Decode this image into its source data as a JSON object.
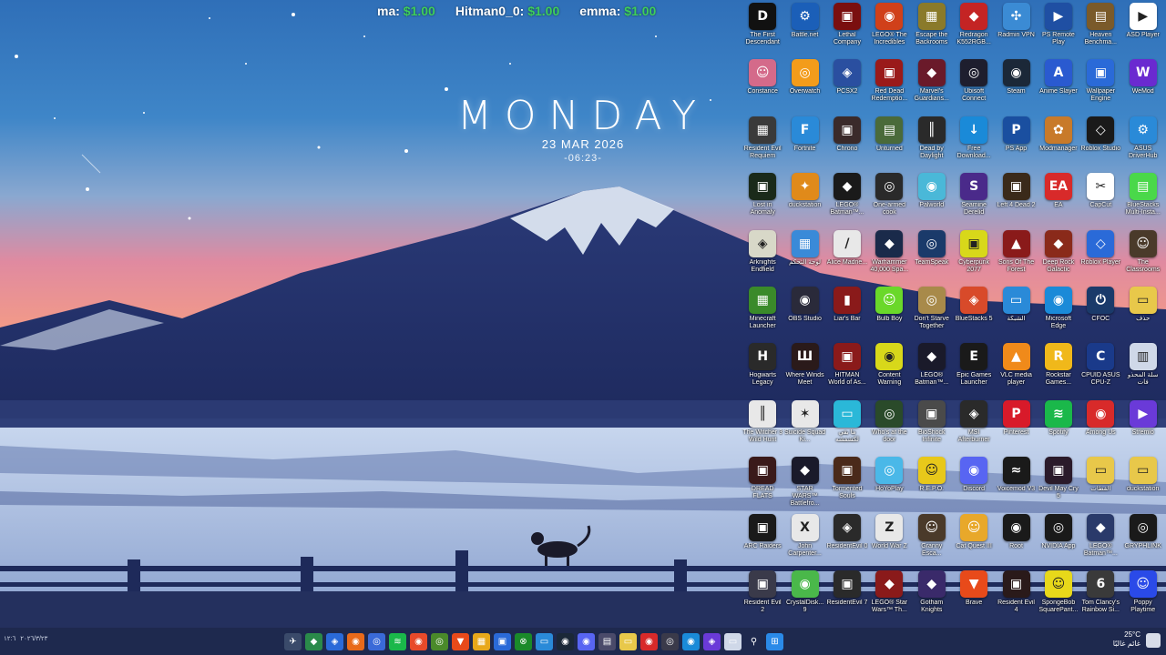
{
  "scoreboard": [
    {
      "name": "ma:",
      "amount": "$1.00"
    },
    {
      "name": "Hitman0_0:",
      "amount": "$1.00"
    },
    {
      "name": "emma:",
      "amount": "$1.00"
    }
  ],
  "clock": {
    "day": "MONDAY",
    "date": "23 MAR 2026",
    "time": "-06:23-"
  },
  "desktop_icons": [
    {
      "label": "The First Descendant",
      "color": "#111111",
      "glyph": "D"
    },
    {
      "label": "Battle.net",
      "color": "#1b5fb8",
      "glyph": "⚙"
    },
    {
      "label": "Lethal Company",
      "color": "#7a0f0f",
      "glyph": "▣"
    },
    {
      "label": "LEGO® The Incredibles",
      "color": "#d0401a",
      "glyph": "◉"
    },
    {
      "label": "Escape the Backrooms",
      "color": "#8a7a2a",
      "glyph": "▦"
    },
    {
      "label": "Redragon K552RGB...",
      "color": "#c42424",
      "glyph": "◆"
    },
    {
      "label": "Radmin VPN",
      "color": "#3b8bd4",
      "glyph": "✣"
    },
    {
      "label": "PS Remote Play",
      "color": "#1f4fa3",
      "glyph": "▶"
    },
    {
      "label": "Heaven Benchma...",
      "color": "#7a5a2a",
      "glyph": "▤"
    },
    {
      "label": "ASD Player",
      "color": "#ffffff",
      "glyph": "▶"
    },
    {
      "label": "Constance",
      "color": "#d46a8a",
      "glyph": "☺"
    },
    {
      "label": "Overwatch",
      "color": "#f39c1a",
      "glyph": "◎"
    },
    {
      "label": "PCSX2",
      "color": "#2a4fa0",
      "glyph": "◈"
    },
    {
      "label": "Red Dead Redemptio...",
      "color": "#9a1a1a",
      "glyph": "▣"
    },
    {
      "label": "Marvel's Guardians...",
      "color": "#6a1a2a",
      "glyph": "◆"
    },
    {
      "label": "Ubisoft Connect",
      "color": "#1e1e2e",
      "glyph": "◎"
    },
    {
      "label": "Steam",
      "color": "#1b2838",
      "glyph": "◉"
    },
    {
      "label": "Anime Slayer",
      "color": "#2a5ad0",
      "glyph": "A"
    },
    {
      "label": "Wallpaper Engine",
      "color": "#2a6ad8",
      "glyph": "▣"
    },
    {
      "label": "WeMod",
      "color": "#6a2ad0",
      "glyph": "W"
    },
    {
      "label": "Resident Evil Requiem",
      "color": "#3a3a3a",
      "glyph": "▦"
    },
    {
      "label": "Fortnite",
      "color": "#2a8ad8",
      "glyph": "F"
    },
    {
      "label": "Chrono",
      "color": "#3a2a2a",
      "glyph": "▣"
    },
    {
      "label": "Unturned",
      "color": "#4a6a3a",
      "glyph": "▤"
    },
    {
      "label": "Dead by Daylight",
      "color": "#2a2a2a",
      "glyph": "║"
    },
    {
      "label": "Free Download...",
      "color": "#1a8ad8",
      "glyph": "↓"
    },
    {
      "label": "PS App",
      "color": "#1a4fa0",
      "glyph": "P"
    },
    {
      "label": "Modmanager",
      "color": "#c87a2a",
      "glyph": "✿"
    },
    {
      "label": "Roblox Studio",
      "color": "#1a1a1a",
      "glyph": "◇"
    },
    {
      "label": "ASUS DriverHub",
      "color": "#2a8ad8",
      "glyph": "⚙"
    },
    {
      "label": "Lost in Anomaly",
      "color": "#1a2a1a",
      "glyph": "▣"
    },
    {
      "label": "duckstation",
      "color": "#e08a1a",
      "glyph": "✦"
    },
    {
      "label": "LEGO® Batman™...",
      "color": "#1a1a1a",
      "glyph": "◆"
    },
    {
      "label": "One-armed cook",
      "color": "#2a2a2a",
      "glyph": "◎"
    },
    {
      "label": "Palworld",
      "color": "#4ab8d8",
      "glyph": "◉"
    },
    {
      "label": "Seamine Derelid",
      "color": "#4a2a8a",
      "glyph": "S"
    },
    {
      "label": "Left 4 Dead 2",
      "color": "#3a2a1a",
      "glyph": "▣"
    },
    {
      "label": "EA",
      "color": "#d82a2a",
      "glyph": "EA"
    },
    {
      "label": "CapCut",
      "color": "#ffffff",
      "glyph": "✂"
    },
    {
      "label": "BlueStacks Multi-Insta...",
      "color": "#4ad84a",
      "glyph": "▤"
    },
    {
      "label": "Arknights Endfield",
      "color": "#d8d8c8",
      "glyph": "◈"
    },
    {
      "label": "لوحة التحكم",
      "color": "#3a8ad8",
      "glyph": "▦"
    },
    {
      "label": "Alice Madne...",
      "color": "#e8e8e8",
      "glyph": "/"
    },
    {
      "label": "Warhammer 40,000 Spa...",
      "color": "#1a2a4a",
      "glyph": "◆"
    },
    {
      "label": "TeamSpeak",
      "color": "#1a3a6a",
      "glyph": "◎"
    },
    {
      "label": "Cyberpunk 2077",
      "color": "#d8d81a",
      "glyph": "▣"
    },
    {
      "label": "Sons Of The Forest",
      "color": "#8a1a1a",
      "glyph": "▲"
    },
    {
      "label": "Deep Rock Galactic",
      "color": "#8a2a1a",
      "glyph": "◆"
    },
    {
      "label": "Roblox Player",
      "color": "#2a6ad8",
      "glyph": "◇"
    },
    {
      "label": "The Classrooms",
      "color": "#4a3a2a",
      "glyph": "☺"
    },
    {
      "label": "Minecraft Launcher",
      "color": "#3a8a2a",
      "glyph": "▦"
    },
    {
      "label": "OBS Studio",
      "color": "#2a2a3a",
      "glyph": "◉"
    },
    {
      "label": "Liar's Bar",
      "color": "#8a1a1a",
      "glyph": "▮"
    },
    {
      "label": "Bulb Boy",
      "color": "#6ad82a",
      "glyph": "☺"
    },
    {
      "label": "Don't Starve Together",
      "color": "#a88a4a",
      "glyph": "◎"
    },
    {
      "label": "BlueStacks 5",
      "color": "#d84a2a",
      "glyph": "◈"
    },
    {
      "label": "الشبكة",
      "color": "#2a8ad8",
      "glyph": "▭"
    },
    {
      "label": "Microsoft Edge",
      "color": "#1a8ad8",
      "glyph": "◉"
    },
    {
      "label": "CFOC",
      "color": "#1a3a6a",
      "glyph": "⏻"
    },
    {
      "label": "حذف",
      "color": "#e8c84a",
      "glyph": "▭"
    },
    {
      "label": "Hogwarts Legacy",
      "color": "#2a2a2a",
      "glyph": "H"
    },
    {
      "label": "Where Winds Meet",
      "color": "#2a1a1a",
      "glyph": "Ш"
    },
    {
      "label": "HITMAN World of As...",
      "color": "#8a1a1a",
      "glyph": "▣"
    },
    {
      "label": "Content Warning",
      "color": "#d8d81a",
      "glyph": "◉"
    },
    {
      "label": "LEGO® Batman™...",
      "color": "#1a1a2a",
      "glyph": "◆"
    },
    {
      "label": "Epic Games Launcher",
      "color": "#1a1a1a",
      "glyph": "E"
    },
    {
      "label": "VLC media player",
      "color": "#f08a1a",
      "glyph": "▲"
    },
    {
      "label": "Rockstar Games...",
      "color": "#f0b81a",
      "glyph": "R"
    },
    {
      "label": "CPUID ASUS CPU-Z",
      "color": "#1a3a8a",
      "glyph": "C"
    },
    {
      "label": "سلة المحذو فات",
      "color": "#cfd8e8",
      "glyph": "▥"
    },
    {
      "label": "The Witcher 3 Wild Hunt",
      "color": "#e8e8e8",
      "glyph": "║"
    },
    {
      "label": "Suicide Squad Ki...",
      "color": "#e8e8e8",
      "glyph": "✶"
    },
    {
      "label": "ما بقي لكشفشه",
      "color": "#2ab8d8",
      "glyph": "▭"
    },
    {
      "label": "Who's at the door",
      "color": "#2a4a2a",
      "glyph": "◎"
    },
    {
      "label": "BioShock Infinite",
      "color": "#4a4a4a",
      "glyph": "▣"
    },
    {
      "label": "MSI Afterburner",
      "color": "#2a2a2a",
      "glyph": "◈"
    },
    {
      "label": "Pinterest",
      "color": "#d81a2a",
      "glyph": "P"
    },
    {
      "label": "Spotify",
      "color": "#1ab84a",
      "glyph": "≋"
    },
    {
      "label": "Among Us",
      "color": "#d82a2a",
      "glyph": "◉"
    },
    {
      "label": "Stremio",
      "color": "#6a3ad8",
      "glyph": "▶"
    },
    {
      "label": "DREAD FLATS",
      "color": "#3a1a1a",
      "glyph": "▣"
    },
    {
      "label": "STAR WARS™ Battlefro...",
      "color": "#1a1a2a",
      "glyph": "◆"
    },
    {
      "label": "Tormented Souls",
      "color": "#4a2a1a",
      "glyph": "▣"
    },
    {
      "label": "HoYoPlay",
      "color": "#4ab8e8",
      "glyph": "◎"
    },
    {
      "label": "R.E.P.O.",
      "color": "#e8c81a",
      "glyph": "☺"
    },
    {
      "label": "Discord",
      "color": "#5865f2",
      "glyph": "◉"
    },
    {
      "label": "Voicemod V3",
      "color": "#1a1a1a",
      "glyph": "≈"
    },
    {
      "label": "Devil May Cry 5",
      "color": "#2a1a2a",
      "glyph": "▣"
    },
    {
      "label": "القطات",
      "color": "#e8c84a",
      "glyph": "▭"
    },
    {
      "label": "duckstation",
      "color": "#e8c84a",
      "glyph": "▭"
    },
    {
      "label": "ARC Raiders",
      "color": "#1a1a1a",
      "glyph": "▣"
    },
    {
      "label": "John Carpenter...",
      "color": "#e8e8e8",
      "glyph": "X"
    },
    {
      "label": "ResidentEvil 0",
      "color": "#2a2a2a",
      "glyph": "◈"
    },
    {
      "label": "World War Z",
      "color": "#e8e8e8",
      "glyph": "Z"
    },
    {
      "label": "Granny Esca...",
      "color": "#4a3a2a",
      "glyph": "☺"
    },
    {
      "label": "Cat Quest III",
      "color": "#e8a82a",
      "glyph": "☺"
    },
    {
      "label": "Root",
      "color": "#1a1a1a",
      "glyph": "◉"
    },
    {
      "label": "NVIDIA App",
      "color": "#1a1a1a",
      "glyph": "◎"
    },
    {
      "label": "LEGO® Batman™...",
      "color": "#2a3a6a",
      "glyph": "◆"
    },
    {
      "label": "GRYPHLINK",
      "color": "#1a1a1a",
      "glyph": "◎"
    },
    {
      "label": "Resident Evil 2",
      "color": "#3a3a4a",
      "glyph": "▣"
    },
    {
      "label": "CrystalDisk... 9",
      "color": "#4ab84a",
      "glyph": "◉"
    },
    {
      "label": "ResidentEvil 7",
      "color": "#2a2a2a",
      "glyph": "▣"
    },
    {
      "label": "LEGO® Star Wars™ Th...",
      "color": "#8a1a1a",
      "glyph": "◆"
    },
    {
      "label": "Gotham Knights",
      "color": "#3a2a6a",
      "glyph": "◆"
    },
    {
      "label": "Brave",
      "color": "#e84a1a",
      "glyph": "▼"
    },
    {
      "label": "Resident Evil 4",
      "color": "#2a1a1a",
      "glyph": "▣"
    },
    {
      "label": "SpongeBob SquarePant...",
      "color": "#e8d81a",
      "glyph": "☺"
    },
    {
      "label": "Tom Clancy's Rainbow Si...",
      "color": "#3a3a3a",
      "glyph": "6"
    },
    {
      "label": "Poppy Playtime",
      "color": "#2a4ae8",
      "glyph": "☺"
    }
  ],
  "taskbar": {
    "left_tray": [
      "١٢:٦",
      "٢٠٢٦/٣/٢٣"
    ],
    "apps": [
      {
        "name": "app",
        "color": "#3a4a6a",
        "glyph": "✈"
      },
      {
        "name": "app",
        "color": "#2a8a4a",
        "glyph": "◆"
      },
      {
        "name": "app",
        "color": "#2a6ad8",
        "glyph": "◈"
      },
      {
        "name": "firefox",
        "color": "#e86a1a",
        "glyph": "◉"
      },
      {
        "name": "app",
        "color": "#3a6ad8",
        "glyph": "◎"
      },
      {
        "name": "spotify",
        "color": "#1ab84a",
        "glyph": "≋"
      },
      {
        "name": "app",
        "color": "#e84a2a",
        "glyph": "◉"
      },
      {
        "name": "chrome",
        "color": "#4a8a2a",
        "glyph": "◎"
      },
      {
        "name": "brave",
        "color": "#e84a1a",
        "glyph": "▼"
      },
      {
        "name": "app",
        "color": "#e8a81a",
        "glyph": "▦"
      },
      {
        "name": "app",
        "color": "#2a6ad8",
        "glyph": "▣"
      },
      {
        "name": "xbox",
        "color": "#1a8a2a",
        "glyph": "⊗"
      },
      {
        "name": "app",
        "color": "#2a8ad8",
        "glyph": "▭"
      },
      {
        "name": "steam",
        "color": "#1b2838",
        "glyph": "◉"
      },
      {
        "name": "discord",
        "color": "#5865f2",
        "glyph": "◉"
      },
      {
        "name": "app",
        "color": "#4a4a6a",
        "glyph": "▤"
      },
      {
        "name": "explorer",
        "color": "#e8c84a",
        "glyph": "▭"
      },
      {
        "name": "app",
        "color": "#d82a2a",
        "glyph": "◉"
      },
      {
        "name": "app",
        "color": "#3a3a4a",
        "glyph": "◎"
      },
      {
        "name": "edge",
        "color": "#1a8ad8",
        "glyph": "◉"
      },
      {
        "name": "app",
        "color": "#6a3ad8",
        "glyph": "◈"
      },
      {
        "name": "app",
        "color": "#cfd8e8",
        "glyph": "▭"
      },
      {
        "name": "search",
        "color": "transparent",
        "glyph": "⚲"
      },
      {
        "name": "start",
        "color": "#2a8ae8",
        "glyph": "⊞"
      }
    ],
    "temperature": "25°C",
    "weather_text": "غائم غالبًا"
  }
}
